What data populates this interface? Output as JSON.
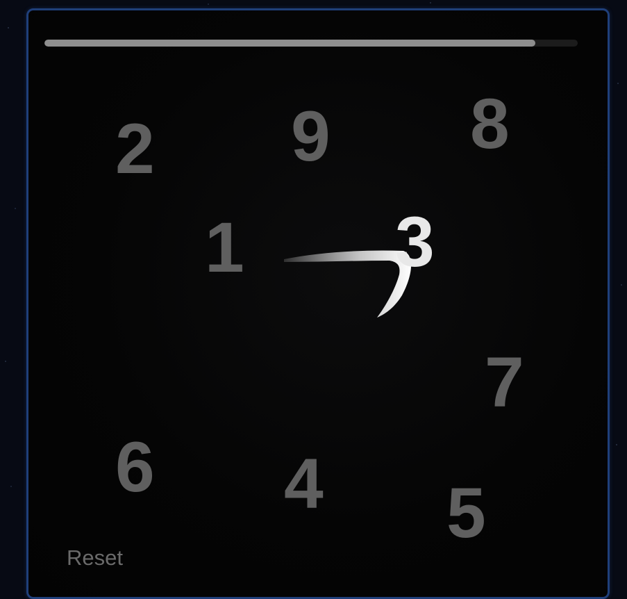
{
  "timer": {
    "progress_percent": 92
  },
  "keypad": {
    "digits": [
      "2",
      "9",
      "8",
      "1",
      "3",
      "7",
      "6",
      "4",
      "5"
    ],
    "active_digit": "3"
  },
  "reset_label": "Reset",
  "colors": {
    "panel_border": "#1f3f7a",
    "digit_inactive": "#5f5f5f",
    "digit_active": "#e8e8e8",
    "timer_fill": "#8e8e8e"
  }
}
